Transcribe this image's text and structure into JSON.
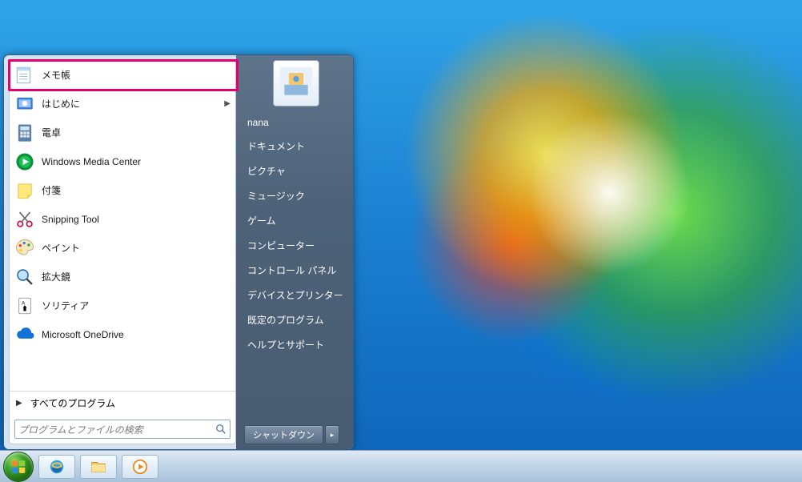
{
  "user": {
    "name": "nana"
  },
  "programs": [
    {
      "id": "notepad",
      "label": "メモ帳",
      "has_submenu": false
    },
    {
      "id": "getting-started",
      "label": "はじめに",
      "has_submenu": true
    },
    {
      "id": "calculator",
      "label": "電卓",
      "has_submenu": false
    },
    {
      "id": "wmc",
      "label": "Windows Media Center",
      "has_submenu": false
    },
    {
      "id": "sticky-notes",
      "label": "付箋",
      "has_submenu": false
    },
    {
      "id": "snipping-tool",
      "label": "Snipping Tool",
      "has_submenu": false
    },
    {
      "id": "paint",
      "label": "ペイント",
      "has_submenu": false
    },
    {
      "id": "magnifier",
      "label": "拡大鏡",
      "has_submenu": false
    },
    {
      "id": "solitaire",
      "label": "ソリティア",
      "has_submenu": false
    },
    {
      "id": "onedrive",
      "label": "Microsoft OneDrive",
      "has_submenu": false
    }
  ],
  "all_programs_label": "すべてのプログラム",
  "search": {
    "placeholder": "プログラムとファイルの検索"
  },
  "right_links": [
    "ドキュメント",
    "ピクチャ",
    "ミュージック",
    "ゲーム",
    "コンピューター",
    "コントロール パネル",
    "デバイスとプリンター",
    "既定のプログラム",
    "ヘルプとサポート"
  ],
  "shutdown_label": "シャットダウン",
  "taskbar": {
    "pinned": [
      "internet-explorer",
      "file-explorer",
      "media-player"
    ]
  }
}
